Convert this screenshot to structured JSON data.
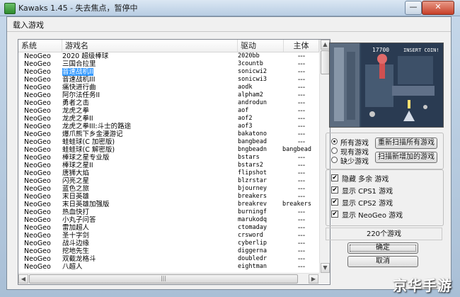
{
  "window": {
    "title": "Kawaks 1.45 - 失去焦点，暂停中",
    "min_label": "—",
    "close_label": "✕"
  },
  "dialog": {
    "title": "载入游戏"
  },
  "list": {
    "columns": [
      "系统",
      "游戏名",
      "驱动",
      "主体"
    ],
    "rows": [
      {
        "system": "NeoGeo",
        "name": "2020 超级棒球",
        "driver": "2020bb",
        "parent": "---"
      },
      {
        "system": "NeoGeo",
        "name": "三国合拉里",
        "driver": "3countb",
        "parent": "---"
      },
      {
        "system": "NeoGeo",
        "name": "音速战机II",
        "driver": "sonicwi2",
        "parent": "---"
      },
      {
        "system": "NeoGeo",
        "name": "音速战机III",
        "driver": "sonicwi3",
        "parent": "---"
      },
      {
        "system": "NeoGeo",
        "name": "痛快进行曲",
        "driver": "aodk",
        "parent": "---"
      },
      {
        "system": "NeoGeo",
        "name": "阿尔法任务II",
        "driver": "alpham2",
        "parent": "---"
      },
      {
        "system": "NeoGeo",
        "name": "勇者之击",
        "driver": "androdun",
        "parent": "---"
      },
      {
        "system": "NeoGeo",
        "name": "龙虎之拳",
        "driver": "aof",
        "parent": "---"
      },
      {
        "system": "NeoGeo",
        "name": "龙虎之拳II",
        "driver": "aof2",
        "parent": "---"
      },
      {
        "system": "NeoGeo",
        "name": "龙虎之拳III:斗士的路途",
        "driver": "aof3",
        "parent": "---"
      },
      {
        "system": "NeoGeo",
        "name": "爆爪熊下乡金漫游记",
        "driver": "bakatono",
        "parent": "---"
      },
      {
        "system": "NeoGeo",
        "name": "蛙蛙球(C 加密版)",
        "driver": "bangbead",
        "parent": "---"
      },
      {
        "system": "NeoGeo",
        "name": "蛙蛙球(C 解密版)",
        "driver": "bngbeadn",
        "parent": "bangbead"
      },
      {
        "system": "NeoGeo",
        "name": "棒球之星专业版",
        "driver": "bstars",
        "parent": "---"
      },
      {
        "system": "NeoGeo",
        "name": "棒球之星II",
        "driver": "bstars2",
        "parent": "---"
      },
      {
        "system": "NeoGeo",
        "name": "唐狮大焰",
        "driver": "flipshot",
        "parent": "---"
      },
      {
        "system": "NeoGeo",
        "name": "闪亮之星",
        "driver": "blzrstar",
        "parent": "---"
      },
      {
        "system": "NeoGeo",
        "name": "蓝色之旅",
        "driver": "bjourney",
        "parent": "---"
      },
      {
        "system": "NeoGeo",
        "name": "末日英雄",
        "driver": "breakers",
        "parent": "---"
      },
      {
        "system": "NeoGeo",
        "name": "末日英雄加强版",
        "driver": "breakrev",
        "parent": "breakers"
      },
      {
        "system": "NeoGeo",
        "name": "热血快打",
        "driver": "burningf",
        "parent": "---"
      },
      {
        "system": "NeoGeo",
        "name": "小丸子问答",
        "driver": "marukodq",
        "parent": "---"
      },
      {
        "system": "NeoGeo",
        "name": "雷加超人",
        "driver": "ctomaday",
        "parent": "---"
      },
      {
        "system": "NeoGeo",
        "name": "圣十字剑",
        "driver": "crsword",
        "parent": "---"
      },
      {
        "system": "NeoGeo",
        "name": "战斗边缘",
        "driver": "cyberlip",
        "parent": "---"
      },
      {
        "system": "NeoGeo",
        "name": "挖地先生",
        "driver": "diggerna",
        "parent": "---"
      },
      {
        "system": "NeoGeo",
        "name": "双截龙格斗",
        "driver": "doubledr",
        "parent": "---"
      },
      {
        "system": "NeoGeo",
        "name": "八超人",
        "driver": "eightman",
        "parent": "---"
      }
    ],
    "hscroll_grip": "|||"
  },
  "filters": {
    "all_games": "所有游戏",
    "current_games": "现有游戏",
    "missing_games": "缺少游戏",
    "selected": "all_games",
    "rescan_all": "重新扫描所有游戏",
    "scan_new": "扫描新增加的游戏"
  },
  "options": {
    "hide_extra": "隐藏 多余 游戏",
    "show_cps1": "显示 CPS1 游戏",
    "show_cps2": "显示 CPS2 游戏",
    "show_neogeo": "显示 NeoGeo 游戏",
    "check_mark": "✔"
  },
  "game_count": "220个游戏",
  "buttons": {
    "ok": "确定",
    "cancel": "取消"
  },
  "preview": {
    "score_label": "17700",
    "insert_coin": "INSERT COIN!"
  },
  "watermark": "京华手游",
  "colors": {
    "selection": "#3399ff",
    "titlebar": "#c6d8ea"
  }
}
